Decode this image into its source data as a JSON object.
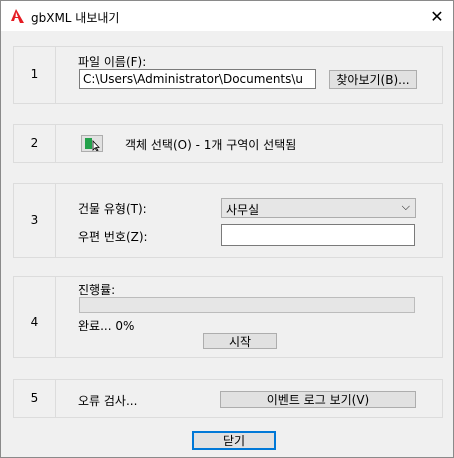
{
  "window": {
    "title": "gbXML 내보내기",
    "close_glyph": "✕"
  },
  "section1": {
    "number": "1",
    "file_name_label": "파일 이름(F):",
    "file_path": "C:\\Users\\Administrator\\Documents\\u",
    "browse_label": "찾아보기(B)..."
  },
  "section2": {
    "number": "2",
    "select_status": "객체 선택(O) - 1개 구역이 선택됨"
  },
  "section3": {
    "number": "3",
    "building_type_label": "건물 유형(T):",
    "building_type_value": "사무실",
    "postal_code_label": "우편 번호(Z):",
    "postal_code_value": ""
  },
  "section4": {
    "number": "4",
    "progress_label": "진행률:",
    "progress": 0,
    "completion_text": "완료... 0%",
    "start_label": "시작"
  },
  "section5": {
    "number": "5",
    "error_check_label": "오류 검사...",
    "event_log_label": "이벤트 로그 보기(V)"
  },
  "footer": {
    "close_label": "닫기"
  },
  "colors": {
    "accent": "#0078d7",
    "app_icon": "#e51c23",
    "progress_fill": "#06b025",
    "select_icon_green": "#22a04a"
  },
  "icons": {
    "app": "autocad-a-icon",
    "select": "select-objects-icon"
  }
}
